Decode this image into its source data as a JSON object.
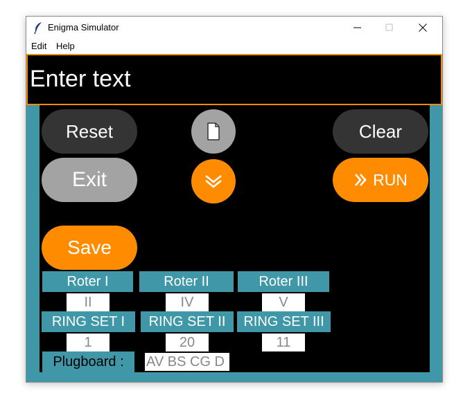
{
  "window": {
    "title": "Enigma Simulator"
  },
  "menu": {
    "items": [
      "Edit",
      "Help"
    ]
  },
  "input": {
    "text": "Enter text"
  },
  "buttons": {
    "reset": "Reset",
    "clear": "Clear",
    "exit": "Exit",
    "run": "RUN",
    "save": "Save"
  },
  "rotors": [
    {
      "label": "Roter I",
      "value": "II",
      "ring_label": "RING SET I",
      "ring_value": "1"
    },
    {
      "label": "Roter II",
      "value": "IV",
      "ring_label": "RING SET II",
      "ring_value": "20"
    },
    {
      "label": "Roter III",
      "value": "V",
      "ring_label": "RING SET III",
      "ring_value": "11"
    }
  ],
  "plugboard": {
    "label": "Plugboard :",
    "value": "AV BS CG D"
  },
  "colors": {
    "accent": "#ff8c00",
    "teal": "#3f97a8",
    "dark_button": "#343434",
    "gray_button": "#a3a3a3",
    "panel": "#000000"
  },
  "icons": {
    "app": "feather-icon",
    "file": "document-icon",
    "toggle": "double-chevron-down-icon",
    "run": "double-chevron-right-icon"
  }
}
